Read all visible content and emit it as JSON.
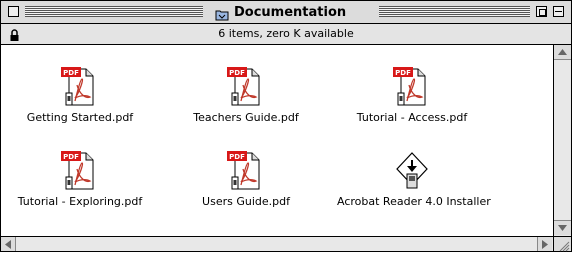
{
  "window": {
    "title": "Documentation",
    "status": "6 items, zero K available"
  },
  "items": [
    {
      "label": "Getting Started.pdf",
      "icon": "pdf-document-icon",
      "badge": "PDF"
    },
    {
      "label": "Teachers Guide.pdf",
      "icon": "pdf-document-icon",
      "badge": "PDF"
    },
    {
      "label": "Tutorial - Access.pdf",
      "icon": "pdf-document-icon",
      "badge": "PDF"
    },
    {
      "label": "Tutorial - Exploring.pdf",
      "icon": "pdf-document-icon",
      "badge": "PDF"
    },
    {
      "label": "Users Guide.pdf",
      "icon": "pdf-document-icon",
      "badge": "PDF"
    },
    {
      "label": "Acrobat Reader 4.0 Installer",
      "icon": "installer-icon"
    }
  ],
  "colors": {
    "pdf_badge": "#d81818",
    "window_chrome": "#dcdcdc"
  }
}
